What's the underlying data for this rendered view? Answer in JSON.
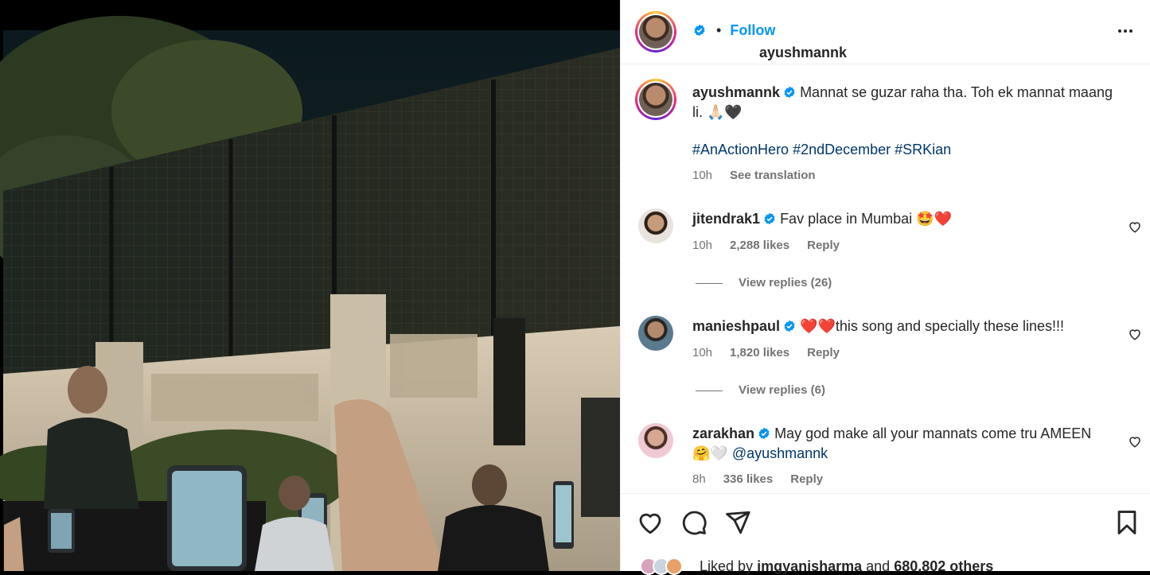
{
  "post": {
    "username": "ayushmannk",
    "follow_label": "Follow",
    "separator": "•",
    "caption": "Mannat se guzar raha tha. Toh ek mannat maang li. 🙏🏻🖤",
    "hashtags": "#AnActionHero #2ndDecember #SRKian",
    "time": "10h",
    "see_translation": "See translation"
  },
  "comments": [
    {
      "username": "jitendrak1",
      "text": "Fav place in Mumbai 🤩❤️",
      "time": "10h",
      "likes": "2,288 likes",
      "reply": "Reply",
      "view_replies": "View replies (26)"
    },
    {
      "username": "manieshpaul",
      "text": "❤️❤️this song and specially these lines!!!",
      "time": "10h",
      "likes": "1,820 likes",
      "reply": "Reply",
      "view_replies": "View replies (6)"
    },
    {
      "username": "zarakhan",
      "text": "May god make all your mannats come tru AMEEN 🤗🤍 ",
      "mention": "@ayushmannk",
      "time": "8h",
      "likes": "336 likes",
      "reply": "Reply"
    }
  ],
  "likes_summary": {
    "prefix": "Liked by",
    "user": "imgyanisharma",
    "middle": "and",
    "count": "680,802 others"
  },
  "icons": {
    "more": "more-options-icon",
    "verified": "verified-badge-icon",
    "like": "heart-icon",
    "comment": "comment-icon",
    "share": "share-icon",
    "save": "bookmark-icon"
  },
  "colors": {
    "follow": "#0095f6",
    "verified": "#0095f6",
    "hashtag": "#00376b",
    "muted": "#737373",
    "text": "#262626"
  }
}
